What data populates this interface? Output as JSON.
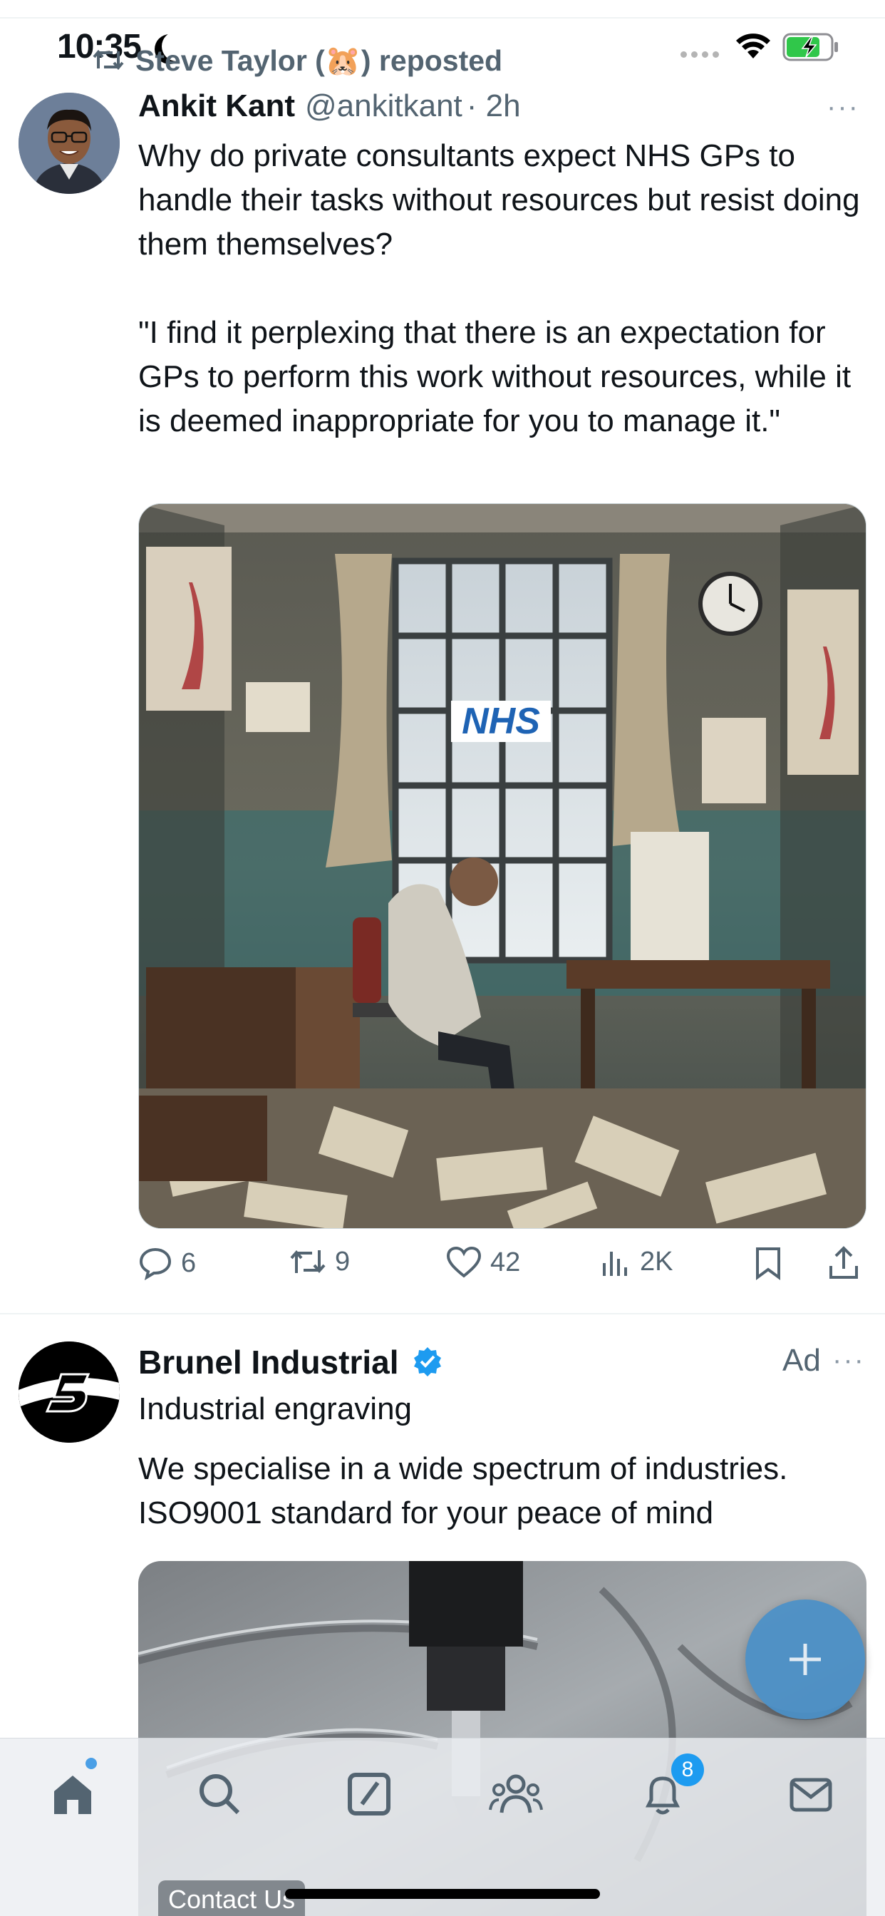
{
  "status_bar": {
    "time": "10:35",
    "icons": [
      "moon-icon",
      "cellular-dots-icon",
      "wifi-icon",
      "battery-charging-icon"
    ]
  },
  "tweet1": {
    "repost_text": "Steve Taylor (🐹) reposted",
    "author_name": "Ankit Kant",
    "handle": "@ankitkant",
    "time": "· 2h",
    "body": [
      "Why do private consultants expect NHS GPs to handle their tasks without resources but resist doing them themselves?",
      "\"I find it perplexing that there is an expectation for GPs to perform this work without resources, while it is deemed inappropriate for you to manage it.\""
    ],
    "image_sign": "NHS",
    "replies": "6",
    "reposts": "9",
    "likes": "42",
    "views": "2K"
  },
  "tweet2": {
    "author_name": "Brunel Industrial",
    "ad_label": "Ad",
    "subtitle": "Industrial engraving",
    "body": [
      "We specialise in a wide spectrum of industries.",
      "ISO9001 standard for your peace of mind"
    ],
    "cta": "Contact Us"
  },
  "more_glyph": "···",
  "tabbar": {
    "items": [
      "home-icon",
      "search-icon",
      "grok-icon",
      "communities-icon",
      "notifications-icon",
      "messages-icon"
    ],
    "notifications_count": "8"
  },
  "colors": {
    "accent": "#1d9bf0",
    "secondary_text": "#536471",
    "fab": "#4a90c8"
  }
}
